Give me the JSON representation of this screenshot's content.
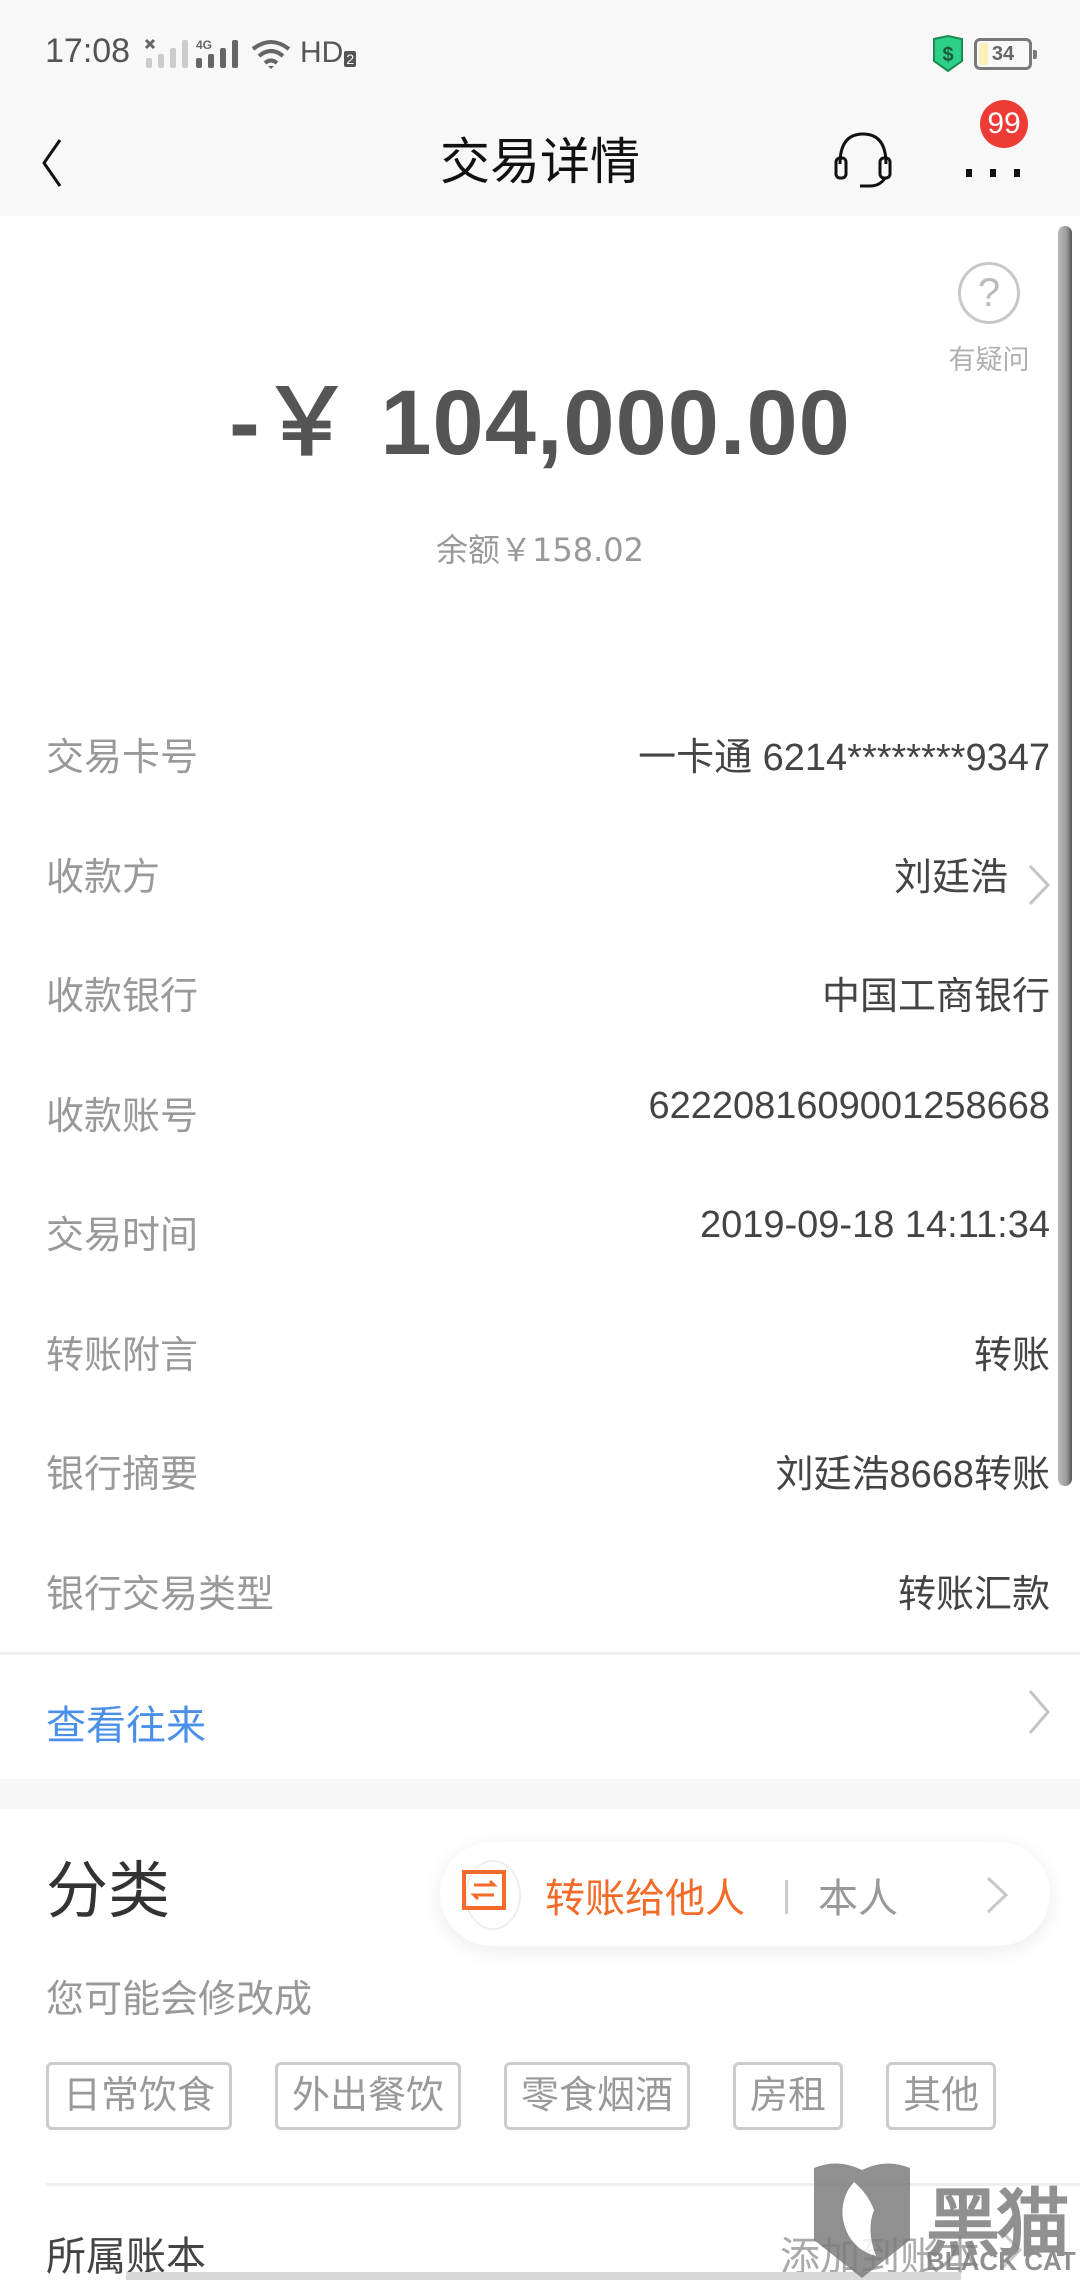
{
  "status_bar": {
    "time": "17:08",
    "sim1_icon": "signal-no-service-icon",
    "sim2_label": "4G",
    "wifi_icon": "wifi-icon",
    "hd_label": "HD",
    "hd_sub": "2",
    "security_icon": "shield-dollar-icon",
    "battery_level": "34",
    "battery_percent": 34
  },
  "nav": {
    "back_icon": "chevron-left-icon",
    "title": "交易详情",
    "support_icon": "headset-icon",
    "more_icon": "more-dots-icon",
    "more_badge": "99"
  },
  "summary": {
    "amount": "-￥ 104,000.00",
    "balance": "余额￥158.02",
    "help_icon_glyph": "?",
    "help_label": "有疑问"
  },
  "details": [
    {
      "label": "交易卡号",
      "value": "一卡通 6214********9347",
      "has_chevron": false
    },
    {
      "label": "收款方",
      "value": "刘廷浩",
      "has_chevron": true
    },
    {
      "label": "收款银行",
      "value": "中国工商银行",
      "has_chevron": false
    },
    {
      "label": "收款账号",
      "value": "6222081609001258668",
      "has_chevron": false
    },
    {
      "label": "交易时间",
      "value": "2019-09-18 14:11:34",
      "has_chevron": false
    },
    {
      "label": "转账附言",
      "value": "转账",
      "has_chevron": false
    },
    {
      "label": "银行摘要",
      "value": "刘廷浩8668转账",
      "has_chevron": false
    },
    {
      "label": "银行交易类型",
      "value": "转账汇款",
      "has_chevron": false
    }
  ],
  "history_link": {
    "label": "查看往来",
    "color": "#4a8fe8"
  },
  "category": {
    "title": "分类",
    "selected": "转账给他人",
    "selected_color": "#f36b28",
    "alternative": "本人",
    "hint": "您可能会修改成",
    "suggestions": [
      "日常饮食",
      "外出餐饮",
      "零食烟酒",
      "房租",
      "其他"
    ]
  },
  "ledger": {
    "label": "所属账本",
    "value": "添加到账本"
  },
  "watermark": {
    "text": "黑猫",
    "subtext": "BLACK CAT"
  }
}
